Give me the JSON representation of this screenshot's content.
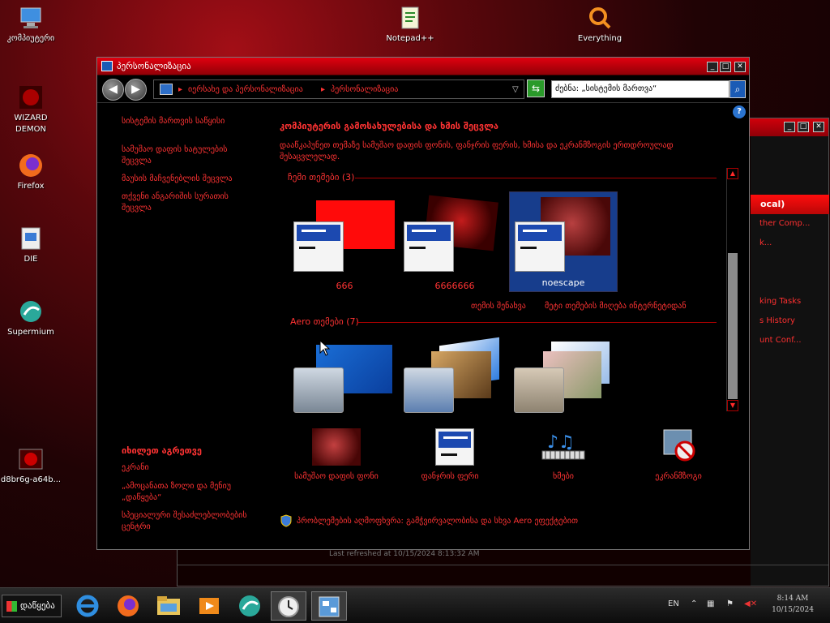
{
  "desktop_icons": [
    {
      "label": "კომპიუტერი",
      "icon": "computer-icon"
    },
    {
      "label": "WIZARD DEMON",
      "icon": "wizard-icon"
    },
    {
      "label": "Firefox",
      "icon": "firefox-icon"
    },
    {
      "label": "DIE",
      "icon": "die-icon"
    },
    {
      "label": "Supermium",
      "icon": "supermium-icon"
    },
    {
      "label": "d8br6g-a64b...",
      "icon": "image-file-icon"
    },
    {
      "label": "Notepad++",
      "icon": "notepad-icon"
    },
    {
      "label": "Everything",
      "icon": "everything-icon"
    }
  ],
  "bg_window": {
    "header": "ocal)",
    "items": [
      "ther Comp...",
      "k...",
      "king Tasks",
      "s History",
      "unt Conf..."
    ],
    "status": "Last refreshed at 10/15/2024 8:13:32 AM"
  },
  "window": {
    "title": "პერსონალიზაცია",
    "breadcrumbs": [
      "იერსახე და პერსონალიზაცია",
      "პერსონალიზაცია"
    ],
    "search_placeholder": "ძებნა: „სისტემის მართვა“",
    "left_links": [
      "სისტემის მართვის საწყისი",
      "სამუშაო დაფის ხატულების შეცვლა",
      "მაუსის მაჩვენებლის შეცვლა",
      "თქვენი ანგარიშის სურათის შეცვლა"
    ],
    "see_also_title": "იხილეთ აგრეთვე",
    "see_also": [
      "ეკრანი",
      "„ამოცანათა ზოლი და მენიუ „დაწყება“",
      "სპეციალური შესაძლებლობების ცენტრი"
    ],
    "heading": "კომპიუტერის გამოსახულებისა და ხმის შეცვლა",
    "description": "დააწკაპუნეთ თემაზე სამუშაო დაფის ფონის, ფანჯრის ფერის, ხმისა და ეკრანმზოგის ერთდროულად შესაცვლელად.",
    "my_themes_label": "ჩემი თემები (3)",
    "my_themes": [
      "666",
      "6666666",
      "noescape"
    ],
    "save_theme": "თემის შენახვა",
    "more_themes": "მეტი თემების მიღება ინტერნეტიდან",
    "aero_label": "Aero თემები (7)",
    "bottom": [
      "სამუშაო დაფის ფონი",
      "ფანჯრის ფერი",
      "ხმები",
      "ეკრანმზოგი"
    ],
    "troubleshoot": "პრობლემების აღმოფხვრა: გამჭვირვალობისა და სხვა Aero ეფექტებით"
  },
  "taskbar": {
    "start": "დაწყება",
    "lang": "EN",
    "time": "8:14 AM",
    "date": "10/15/2024"
  }
}
